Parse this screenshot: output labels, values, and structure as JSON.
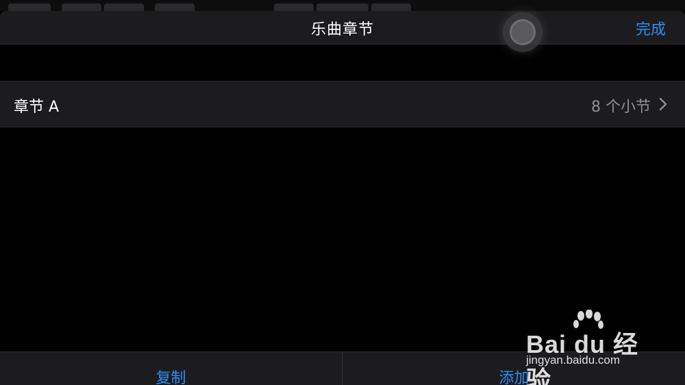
{
  "navbar": {
    "title": "乐曲章节",
    "done_label": "完成"
  },
  "sections": [
    {
      "name": "章节 A",
      "bar_count_label": "8 个小节"
    }
  ],
  "toolbar": {
    "copy_label": "复制",
    "add_label": "添加"
  },
  "watermark": {
    "brand": "Bai du 经验",
    "url": "jingyan.baidu.com"
  },
  "colors": {
    "accent": "#2f8cf6",
    "background": "#000000",
    "surface": "#1c1c1e",
    "secondary_text": "#8e8e93"
  },
  "icons": {
    "row_chevron": "chevron-right-icon",
    "floating_button": "assistive-touch-icon",
    "watermark_logo": "baidu-paw-icon"
  }
}
